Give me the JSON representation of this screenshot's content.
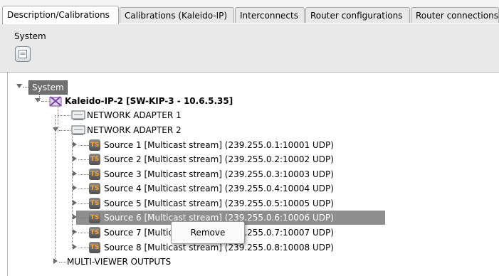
{
  "tabs": [
    {
      "label": "Description/Calibrations",
      "active": true
    },
    {
      "label": "Calibrations (Kaleido-IP)",
      "active": false
    },
    {
      "label": "Interconnects",
      "active": false
    },
    {
      "label": "Router configurations",
      "active": false
    },
    {
      "label": "Router connections",
      "active": false
    }
  ],
  "toolbar": {
    "system_label": "System"
  },
  "tree": {
    "root": "System",
    "device": "Kaleido-IP-2 [SW-KIP-3 - 10.6.5.35]",
    "adapters": [
      "NETWORK ADAPTER 1",
      "NETWORK ADAPTER 2"
    ],
    "ts_badge": "TS",
    "sources": [
      "Source 1 [Multicast stream] (239.255.0.1:10001 UDP)",
      "Source 2 [Multicast stream] (239.255.0.2:10002 UDP)",
      "Source 3 [Multicast stream] (239.255.0.3:10003 UDP)",
      "Source 4 [Multicast stream] (239.255.0.4:10004 UDP)",
      "Source 5 [Multicast stream] (239.255.0.5:10005 UDP)",
      "Source 6 [Multicast stream] (239.255.0.6:10006 UDP)",
      "Source 7 [Multicast stream] (239.255.0.7:10007 UDP)",
      "Source 8 [Multicast stream] (239.255.0.8:10008 UDP)"
    ],
    "selected_source_index": 5,
    "outputs": "MULTI-VIEWER OUTPUTS"
  },
  "context_menu": {
    "items": [
      "Remove"
    ]
  },
  "colors": {
    "selection": "#8e8e8e",
    "ts_badge_text": "#f6a33a",
    "device_icon": "#7a3fa0"
  }
}
